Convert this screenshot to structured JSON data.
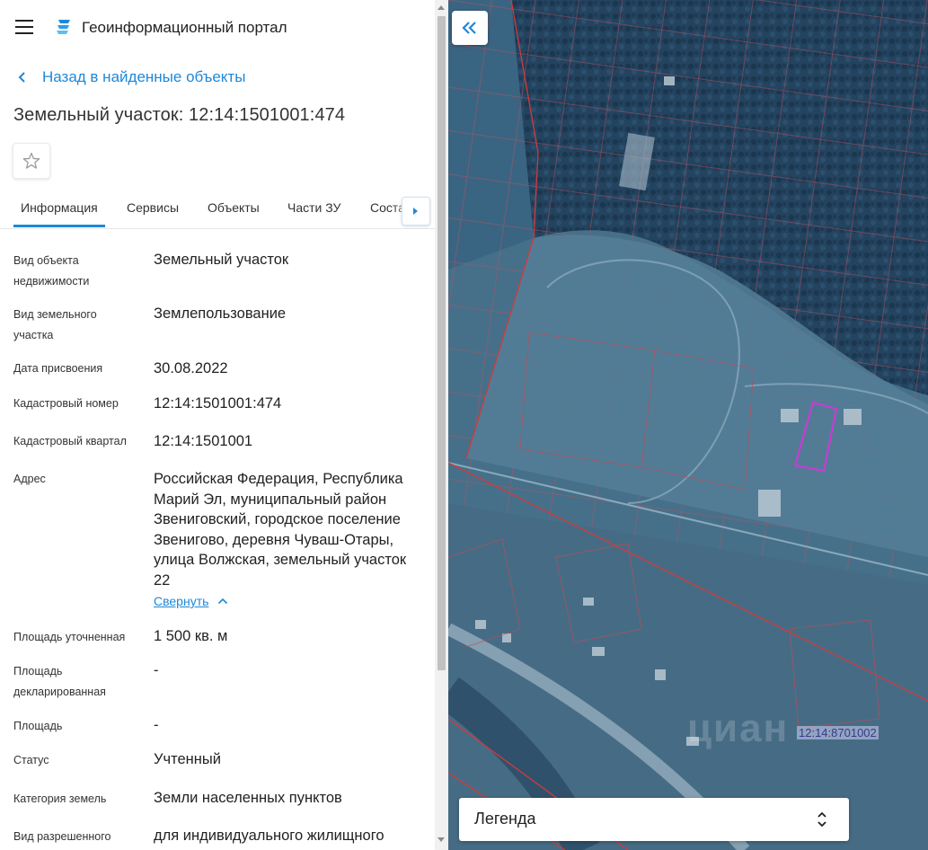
{
  "header": {
    "title": "Геоинформационный портал",
    "menu_icon": "hamburger-icon",
    "logo_icon": "portal-logo-icon"
  },
  "navigation": {
    "back_label": "Назад в найденные объекты"
  },
  "object": {
    "title": "Земельный участок: 12:14:1501001:474",
    "favorite_icon": "star-outline-icon"
  },
  "tabs": [
    {
      "label": "Информация",
      "active": true
    },
    {
      "label": "Сервисы"
    },
    {
      "label": "Объекты"
    },
    {
      "label": "Части ЗУ"
    },
    {
      "label": "Соста"
    }
  ],
  "properties": [
    {
      "label": "Вид объекта недвижимости",
      "value": "Земельный участок"
    },
    {
      "label": "Вид земельного участка",
      "value": "Землепользование"
    },
    {
      "label": "Дата присвоения",
      "value": "30.08.2022"
    },
    {
      "label": "Кадастровый номер",
      "value": "12:14:1501001:474"
    },
    {
      "label": "Кадастровый квартал",
      "value": "12:14:1501001"
    },
    {
      "label": "Адрес",
      "value": "Российская Федерация, Республика Марий Эл, муниципальный район Звениговский, городское поселение Звенигово, деревня Чуваш-Отары, улица Волжская, земельный участок 22"
    },
    {
      "label": "Площадь уточненная",
      "value": "1 500 кв. м"
    },
    {
      "label": "Площадь декларированная",
      "value": "-"
    },
    {
      "label": "Площадь",
      "value": "-"
    },
    {
      "label": "Статус",
      "value": "Учтенный"
    },
    {
      "label": "Категория земель",
      "value": "Земли населенных пунктов"
    },
    {
      "label": "Вид разрешенного",
      "value": "для индивидуального жилищного"
    }
  ],
  "collapse_label": "Свернуть",
  "map": {
    "legend_label": "Легенда",
    "cadastral_label": "12:14:8701002",
    "watermark": "циан",
    "colors": {
      "boundary": "#d23a3a",
      "selected_parcel": "#c83cd2",
      "accent": "#1e88d8"
    }
  }
}
